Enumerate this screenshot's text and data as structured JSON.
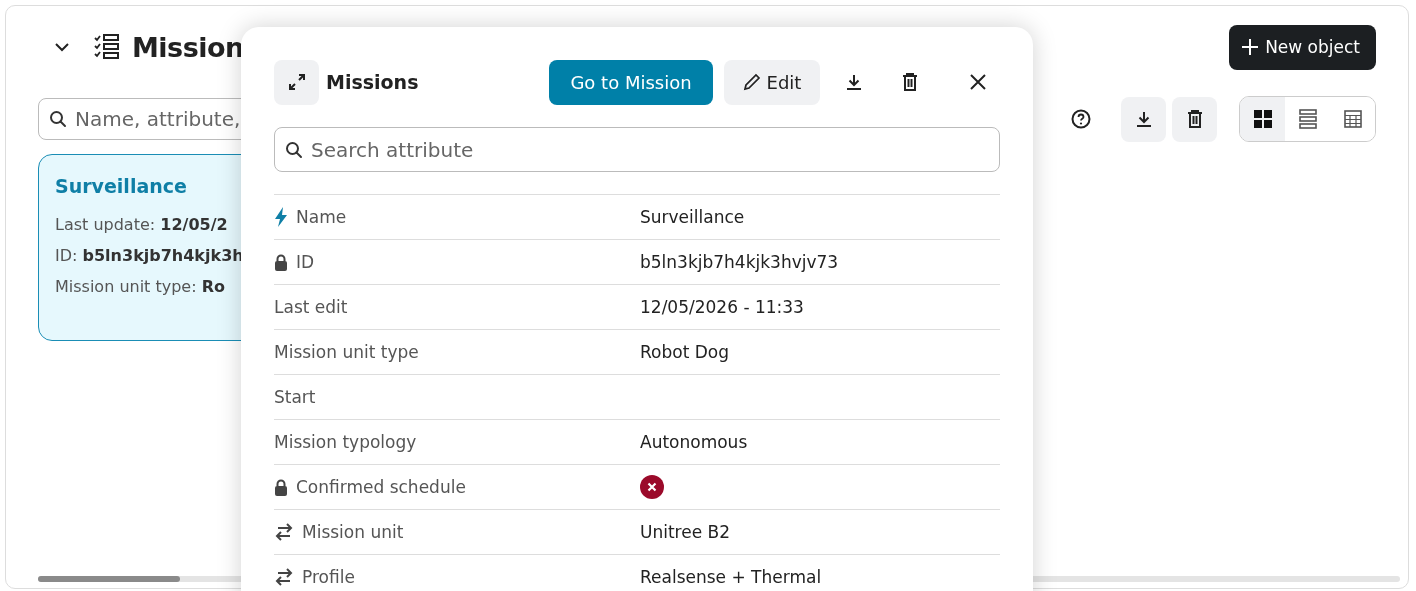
{
  "header": {
    "title": "Mission",
    "new_button": "New object"
  },
  "search": {
    "placeholder": "Name, attribute,"
  },
  "view_modes": [
    {
      "kind": "grid",
      "selected": true
    },
    {
      "kind": "list",
      "selected": false
    },
    {
      "kind": "table",
      "selected": false
    }
  ],
  "card": {
    "title": "Surveillance",
    "selected": true,
    "fields": [
      {
        "label": "Last update:",
        "value": "12/05/2"
      },
      {
        "label": "ID:",
        "value": "b5ln3kjb7h4kjk3h"
      },
      {
        "label": "Mission unit type:",
        "value": "Ro"
      }
    ]
  },
  "modal": {
    "title": "Missions",
    "primary_button": "Go to Mission",
    "edit_button": "Edit",
    "search_placeholder": "Search attribute",
    "rows": [
      {
        "kind": "computed",
        "label": "Name",
        "value": "Surveillance"
      },
      {
        "kind": "readonly",
        "label": "ID",
        "value": "b5ln3kjb7h4kjk3hvjv73"
      },
      {
        "kind": "plain",
        "label": "Last edit",
        "value": "12/05/2026 - 11:33"
      },
      {
        "kind": "plain",
        "label": "Mission unit type",
        "value": "Robot Dog"
      },
      {
        "kind": "plain",
        "label": "Start"
      },
      {
        "kind": "plain",
        "label": "Mission typology",
        "value": "Autonomous"
      },
      {
        "kind": "readonly",
        "label": "Confirmed schedule",
        "checked": false
      },
      {
        "kind": "relation",
        "label": "Mission unit",
        "value": "Unitree B2"
      },
      {
        "kind": "relation",
        "label": "Profile",
        "value": "Realsense + Thermal"
      }
    ]
  }
}
